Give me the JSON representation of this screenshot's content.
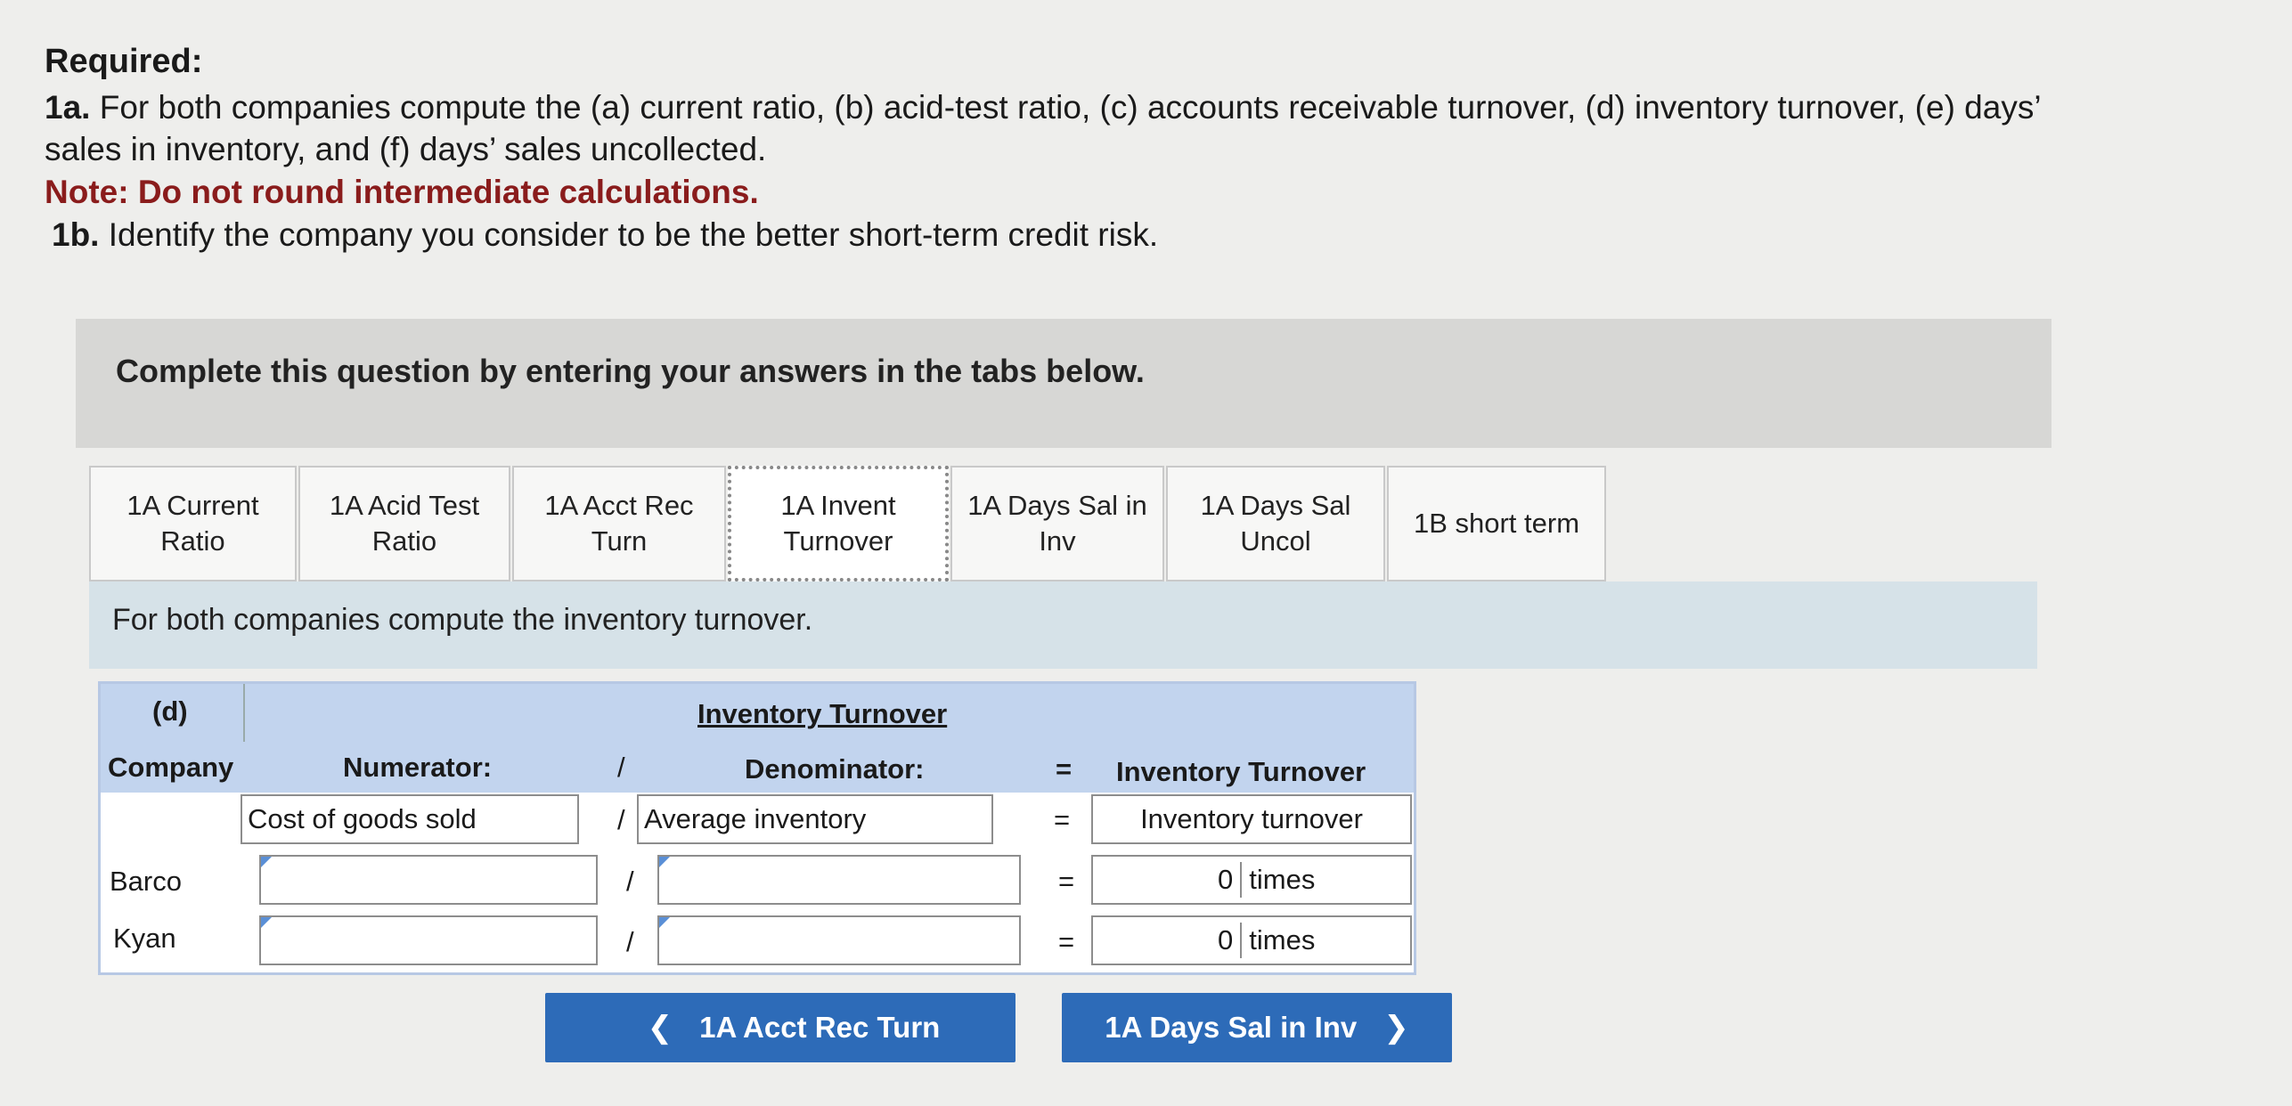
{
  "instructions": {
    "required": "Required:",
    "line1_prefix": "1a.",
    "line1_text": "For both companies compute the (a) current ratio, (b) acid-test ratio, (c) accounts receivable turnover, (d) inventory turnover, (e) days’",
    "line2_text": "sales in inventory, and (f) days’ sales uncollected.",
    "note": "Note: Do not round intermediate calculations.",
    "line4_prefix": "1b.",
    "line4_text": "Identify the company you consider to be the better short-term credit risk."
  },
  "banner": {
    "text": "Complete this question by entering your answers in the tabs below."
  },
  "tabs": [
    {
      "label": "1A Current\nRatio"
    },
    {
      "label": "1A Acid Test\nRatio"
    },
    {
      "label": "1A Acct Rec\nTurn"
    },
    {
      "label": "1A Invent\nTurnover"
    },
    {
      "label": "1A Days Sal in\nInv"
    },
    {
      "label": "1A Days Sal\nUncol"
    },
    {
      "label": "1B short term"
    }
  ],
  "subheader": {
    "text": "For both companies compute the inventory turnover."
  },
  "grid": {
    "part_label": "(d)",
    "title": "Inventory Turnover",
    "col_company": "Company",
    "col_numerator": "Numerator:",
    "slash": "/",
    "col_denominator": "Denominator:",
    "equals": "=",
    "col_result": "Inventory Turnover",
    "formula_numerator": "Cost of goods sold",
    "formula_denominator": "Average inventory",
    "formula_result": "Inventory turnover",
    "rows": [
      {
        "company": "Barco",
        "numerator": "",
        "denominator": "",
        "value": "0",
        "unit": "times"
      },
      {
        "company": "Kyan",
        "numerator": "",
        "denominator": "",
        "value": "0",
        "unit": "times"
      }
    ]
  },
  "nav": {
    "prev_label": "1A Acct Rec Turn",
    "next_label": "1A Days Sal in Inv",
    "prev_icon": "chevron-left-icon",
    "next_icon": "chevron-right-icon"
  }
}
